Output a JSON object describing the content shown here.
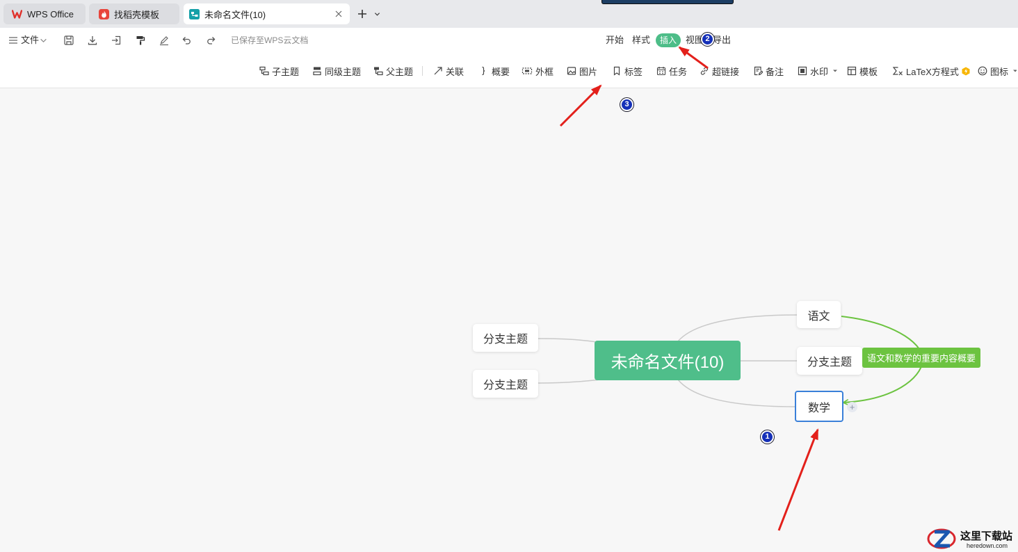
{
  "window": {
    "tabs": [
      {
        "label": "WPS Office",
        "icon": "wps-logo-icon"
      },
      {
        "label": "找稻壳模板",
        "icon": "docer-icon"
      },
      {
        "label": "未命名文件(10)",
        "icon": "mindmap-file-icon",
        "active": true
      }
    ]
  },
  "quickbar": {
    "file_menu_label": "文件",
    "save_status": "已保存至WPS云文档",
    "icons": [
      "menu-icon",
      "save-icon",
      "download-icon",
      "export-icon",
      "format-painter-icon",
      "pen-icon",
      "undo-icon",
      "redo-icon"
    ]
  },
  "menu": {
    "tabs": [
      {
        "label": "开始"
      },
      {
        "label": "样式"
      },
      {
        "label": "插入",
        "active": true
      },
      {
        "label": "视图"
      },
      {
        "label": "导出"
      }
    ]
  },
  "insert_toolbar": {
    "items": [
      {
        "label": "子主题",
        "icon": "subtopic-icon"
      },
      {
        "label": "同级主题",
        "icon": "sibling-topic-icon"
      },
      {
        "label": "父主题",
        "icon": "parent-topic-icon"
      },
      {
        "label": "关联",
        "icon": "relationship-icon"
      },
      {
        "label": "概要",
        "icon": "summary-icon"
      },
      {
        "label": "外框",
        "icon": "boundary-icon"
      },
      {
        "label": "图片",
        "icon": "image-icon"
      },
      {
        "label": "标签",
        "icon": "tag-icon"
      },
      {
        "label": "任务",
        "icon": "task-icon"
      },
      {
        "label": "超链接",
        "icon": "hyperlink-icon"
      },
      {
        "label": "备注",
        "icon": "note-icon"
      },
      {
        "label": "水印",
        "icon": "watermark-icon",
        "has_dropdown": true
      },
      {
        "label": "模板",
        "icon": "template-icon"
      },
      {
        "label": "LaTeX方程式",
        "icon": "latex-icon",
        "badge": "vip-lightning-icon"
      },
      {
        "label": "图标",
        "icon": "emoji-icon",
        "has_dropdown": true
      }
    ]
  },
  "mindmap": {
    "root": {
      "label": "未命名文件(10)"
    },
    "left_branches": [
      {
        "label": "分支主题"
      },
      {
        "label": "分支主题"
      }
    ],
    "right_branches": [
      {
        "label": "语文"
      },
      {
        "label": "分支主题"
      },
      {
        "label": "数学",
        "selected": true
      }
    ],
    "summary": {
      "label": "语文和数学的重要内容概要"
    },
    "add_child_label": "+"
  },
  "annotations": {
    "markers": [
      {
        "label": "1"
      },
      {
        "label": "2"
      },
      {
        "label": "3"
      }
    ]
  },
  "watermark": {
    "name": "这里下载站",
    "domain": "heredown.com"
  },
  "colors": {
    "root_green": "#4fbe8a",
    "summary_green": "#6cc340",
    "selected_blue": "#3a80d9",
    "annotation_red": "#e3201b",
    "marker_blue": "#1530b8"
  }
}
